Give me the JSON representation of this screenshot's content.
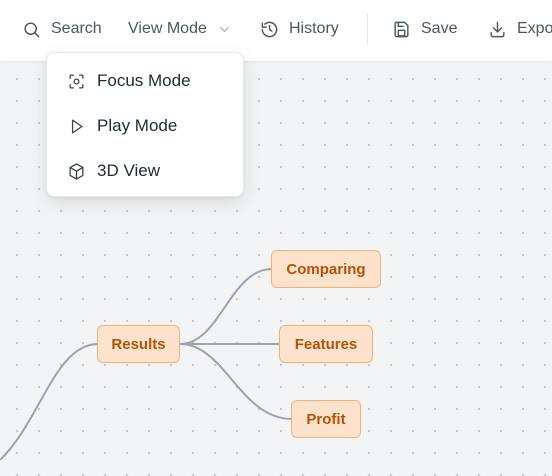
{
  "toolbar": {
    "search_label": "Search",
    "view_mode_label": "View Mode",
    "history_label": "History",
    "save_label": "Save",
    "export_label": "Expo"
  },
  "view_mode_menu": {
    "items": [
      {
        "label": "Focus Mode",
        "icon": "focus-icon"
      },
      {
        "label": "Play Mode",
        "icon": "play-icon"
      },
      {
        "label": "3D View",
        "icon": "cube-icon"
      }
    ]
  },
  "mindmap": {
    "nodes": {
      "results": "Results",
      "comparing": "Comparing",
      "features": "Features",
      "profit": "Profit"
    }
  },
  "colors": {
    "node_fill": "#fde2cc",
    "node_border": "#f5b07a",
    "node_text": "#b45309",
    "edge": "#9ca3af"
  }
}
